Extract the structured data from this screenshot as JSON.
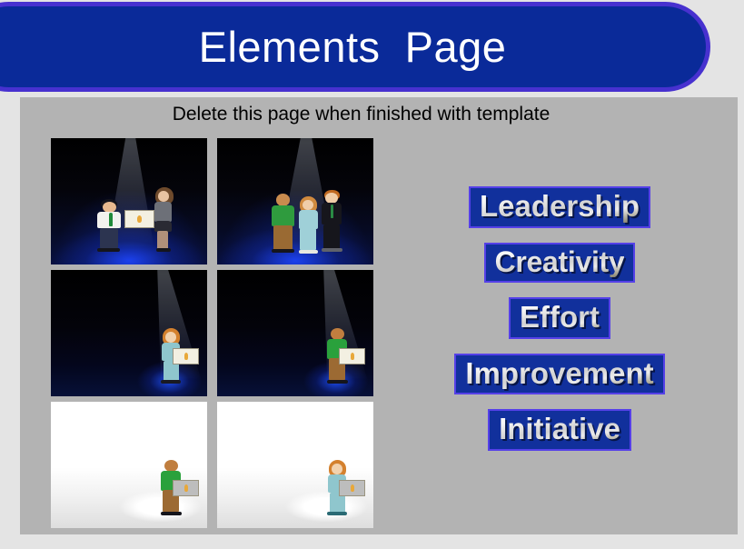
{
  "page": {
    "title": "Elements  Page",
    "subtitle": "Delete this page when finished with template",
    "background_color": "#e4e4e4",
    "panel_color": "#b3b3b3"
  },
  "banner": {
    "fill_color": "#0a2a99",
    "border_color": "#4731cf",
    "text_color": "#ffffff"
  },
  "thumbnails": [
    {
      "name": "award-presentation-dark",
      "scene": "dark-stage",
      "description": "Man in white shirt receiving certificate from woman in grey suit on blue-lit stage"
    },
    {
      "name": "three-people-spotlight-dark",
      "scene": "dark-stage",
      "description": "Three people standing together under a spotlight on blue-lit stage"
    },
    {
      "name": "woman-with-certificate-dark",
      "scene": "dark-stage-right",
      "description": "Woman in teal suit holding a certificate under a spotlight"
    },
    {
      "name": "man-with-certificate-dark",
      "scene": "dark-stage-right",
      "description": "Man in green shirt holding a certificate under a spotlight"
    },
    {
      "name": "man-with-certificate-white",
      "scene": "white-stage",
      "description": "Man in green shirt holding a certificate on a white background"
    },
    {
      "name": "woman-with-certificate-white",
      "scene": "white-stage",
      "description": "Woman in teal suit holding a certificate on a white background"
    }
  ],
  "wordart": {
    "fill_color": "#11309c",
    "border_color": "#5540e8",
    "items": [
      {
        "label": "Leadership"
      },
      {
        "label": "Creativity"
      },
      {
        "label": "Effort"
      },
      {
        "label": "Improvement"
      },
      {
        "label": "Initiative"
      }
    ]
  }
}
